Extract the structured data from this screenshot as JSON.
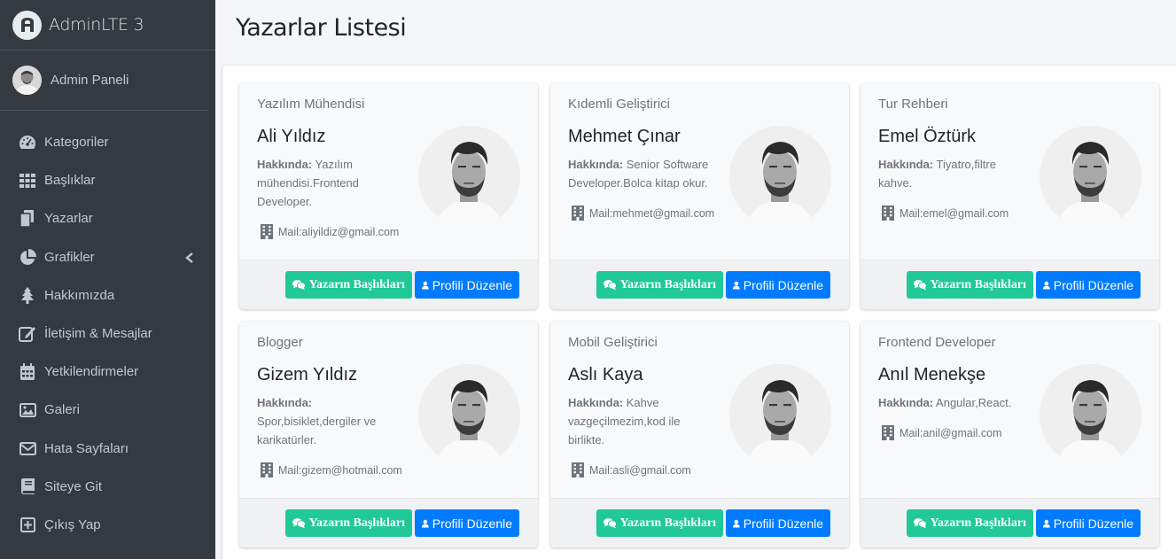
{
  "brand": {
    "name": "AdminLTE 3"
  },
  "user": {
    "name": "Admin Paneli"
  },
  "nav": [
    {
      "label": "Kategoriler",
      "icon": "tachometer-icon"
    },
    {
      "label": "Başlıklar",
      "icon": "grid-icon"
    },
    {
      "label": "Yazarlar",
      "icon": "copy-icon"
    },
    {
      "label": "Grafikler",
      "icon": "pie-chart-icon",
      "chevron": true
    },
    {
      "label": "Hakkımızda",
      "icon": "tree-icon"
    },
    {
      "label": "İletişim & Mesajlar",
      "icon": "edit-icon"
    },
    {
      "label": "Yetkilendirmeler",
      "icon": "calendar-icon"
    },
    {
      "label": "Galeri",
      "icon": "image-icon"
    },
    {
      "label": "Hata Sayfaları",
      "icon": "envelope-icon"
    },
    {
      "label": "Siteye Git",
      "icon": "book-icon"
    },
    {
      "label": "Çıkış Yap",
      "icon": "plus-square-icon"
    }
  ],
  "page": {
    "title": "Yazarlar Listesi"
  },
  "about_label": "Hakkında:",
  "buttons": {
    "posts": "Yazarın Başlıkları",
    "edit": "Profili Düzenle"
  },
  "authors": [
    {
      "role": "Yazılım Mühendisi",
      "name": "Ali Yıldız",
      "about": "Yazılım mühendisi.Frontend Developer.",
      "mail": "Mail:aliyildiz@gmail.com"
    },
    {
      "role": "Kıdemli Geliştirici",
      "name": "Mehmet Çınar",
      "about": "Senior Software Developer.Bolca kitap okur.",
      "mail": "Mail:mehmet@gmail.com"
    },
    {
      "role": "Tur Rehberi",
      "name": "Emel Öztürk",
      "about": "Tiyatro,filtre kahve.",
      "mail": "Mail:emel@gmail.com"
    },
    {
      "role": "Blogger",
      "name": "Gizem Yıldız",
      "about": "Spor,bisiklet,dergiler ve karikatürler.",
      "mail": "Mail:gizem@hotmail.com"
    },
    {
      "role": "Mobil Geliştirici",
      "name": "Aslı Kaya",
      "about": "Kahve vazgeçilmezim,kod ile birlikte.",
      "mail": "Mail:asli@gmail.com"
    },
    {
      "role": "Frontend Developer",
      "name": "Anıl Menekşe",
      "about": "Angular,React.",
      "mail": "Mail:anil@gmail.com"
    }
  ],
  "colors": {
    "sidebar": "#343a40",
    "green": "#20c997",
    "blue": "#007bff"
  }
}
